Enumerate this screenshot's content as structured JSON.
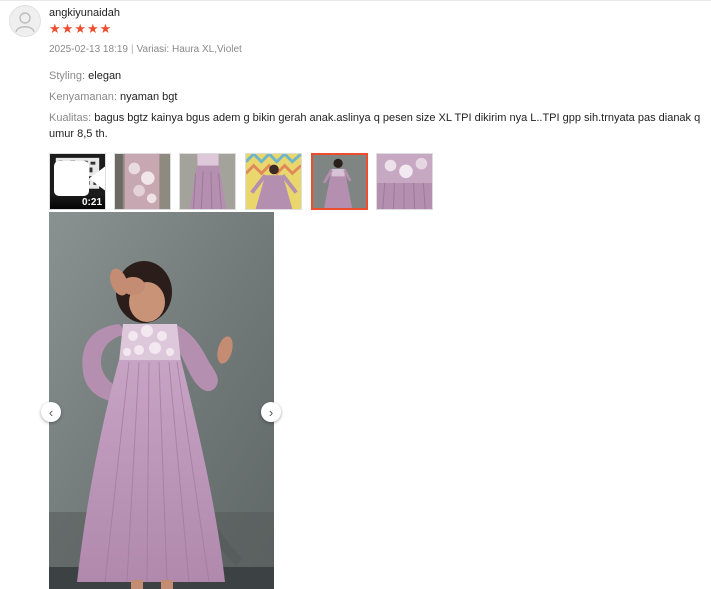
{
  "review": {
    "username": "angkiyunaidah",
    "rating": 5,
    "stars": [
      "★",
      "★",
      "★",
      "★",
      "★"
    ],
    "date": "2025-02-13 18:19",
    "variant_label": "Variasi:",
    "variant_value": "Haura XL,Violet",
    "attributes": {
      "styling": {
        "label": "Styling:",
        "value": "elegan"
      },
      "kenyamanan": {
        "label": "Kenyamanan:",
        "value": "nyaman bgt"
      },
      "kualitas": {
        "label": "Kualitas:",
        "value": "bagus bgtz kainya bgus adem g bikin gerah anak.aslinya q pesen size XL TPI dikirim nya L..TPI gpp sih.trnyata pas dianak q umur 8,5 th."
      }
    }
  },
  "media": {
    "video_duration": "0:21",
    "thumbnails": [
      {
        "type": "video",
        "icon": "video-camera-icon"
      },
      {
        "type": "photo"
      },
      {
        "type": "photo"
      },
      {
        "type": "photo"
      },
      {
        "type": "photo",
        "selected": true
      },
      {
        "type": "photo"
      }
    ],
    "prev_icon": "‹",
    "next_icon": "›"
  },
  "colors": {
    "accent": "#ee4d2d",
    "muted_text": "#8a8a8a",
    "dress": "#b48fb0"
  }
}
